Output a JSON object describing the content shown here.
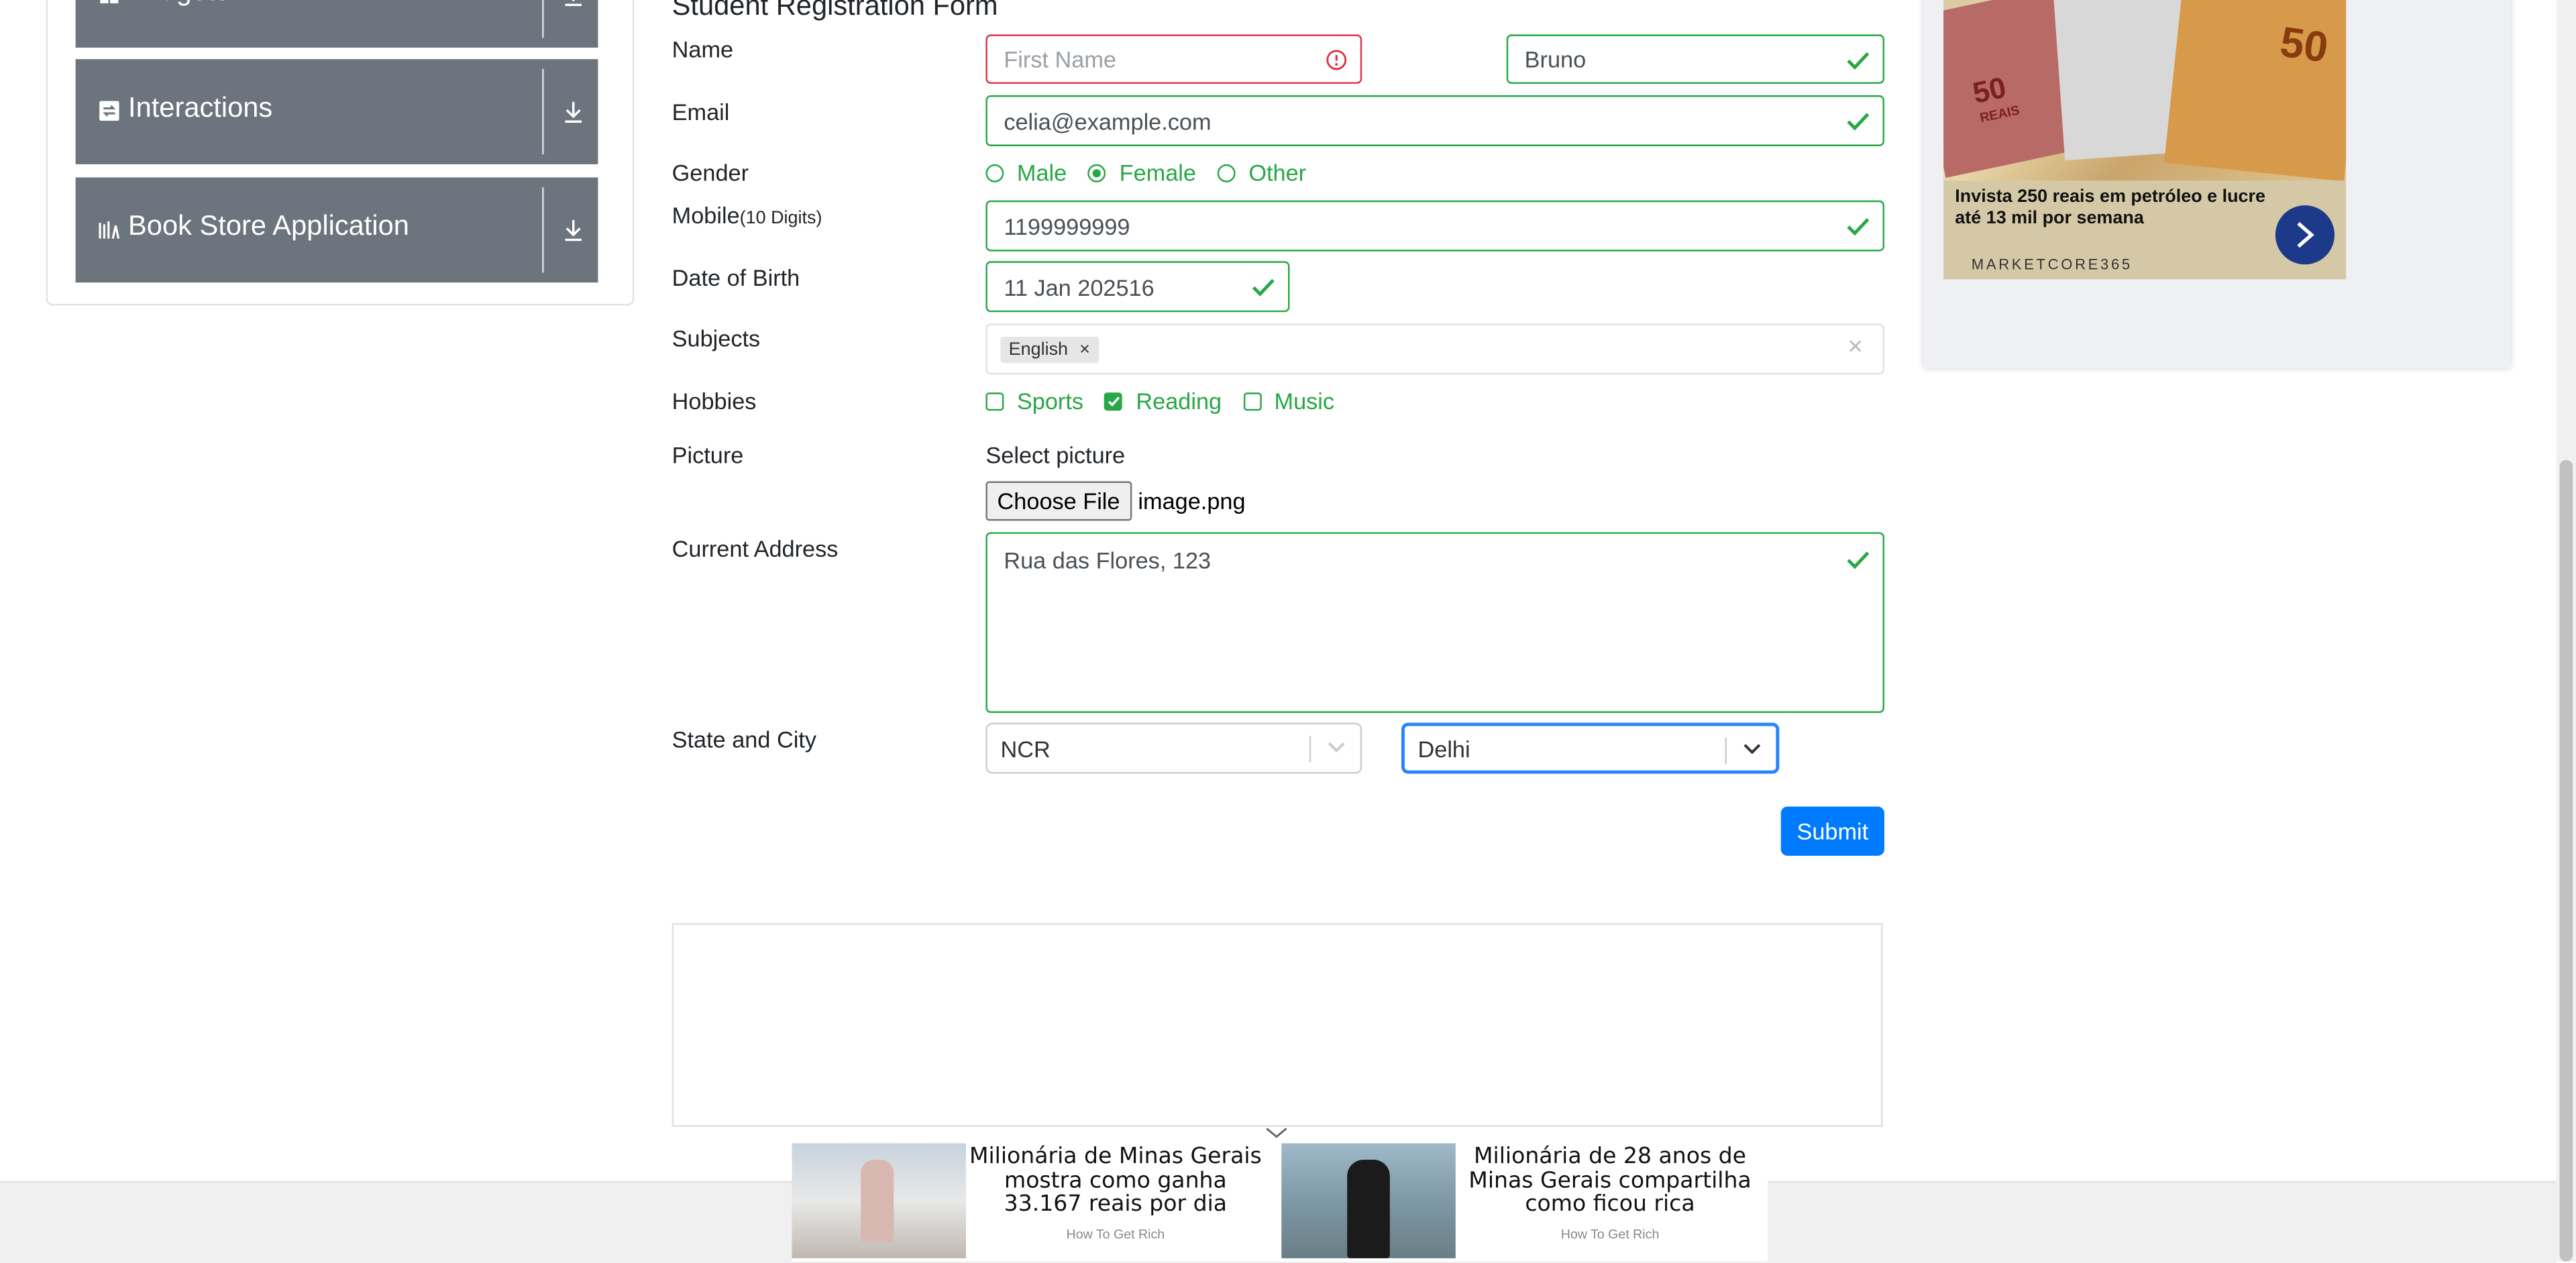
{
  "sidebar": {
    "groups": [
      {
        "title": "Widgets"
      },
      {
        "title": "Interactions"
      },
      {
        "title": "Book Store Application"
      }
    ]
  },
  "form": {
    "title": "Student Registration Form",
    "labels": {
      "name": "Name",
      "email": "Email",
      "gender": "Gender",
      "mobile": "Mobile",
      "mobile_hint": "(10 Digits)",
      "dob": "Date of Birth",
      "subjects": "Subjects",
      "hobbies": "Hobbies",
      "picture": "Picture",
      "address": "Current Address",
      "state_city": "State and City"
    },
    "first_name": {
      "value": "",
      "placeholder": "First Name"
    },
    "last_name": {
      "value": "Bruno"
    },
    "email": {
      "value": "celia@example.com"
    },
    "gender": {
      "options": [
        "Male",
        "Female",
        "Other"
      ],
      "selected": "Female"
    },
    "mobile": {
      "value": "1199999999"
    },
    "dob": {
      "value": "11 Jan 202516"
    },
    "subjects": {
      "chips": [
        "English"
      ]
    },
    "hobbies": {
      "options": [
        "Sports",
        "Reading",
        "Music"
      ],
      "checked": [
        "Reading"
      ]
    },
    "picture": {
      "select_label": "Select picture",
      "button_label": "Choose File",
      "file_name": "image.png"
    },
    "address": {
      "value": "Rua das Flores, 123"
    },
    "state": {
      "value": "NCR"
    },
    "city": {
      "value": "Delhi"
    },
    "submit_label": "Submit"
  },
  "ads": {
    "right": {
      "headline": "Invista 250 reais em petróleo e lucre até 13 mil por semana",
      "brand": "MARKETCORE365",
      "banknote_text": "50",
      "banknote_word": "REAIS"
    },
    "bottom": [
      {
        "headline": "Milionária de Minas Gerais mostra como ganha 33.167 reais por dia",
        "source": "How To Get Rich"
      },
      {
        "headline": "Milionária de 28 anos de Minas Gerais compartilha como ficou rica",
        "source": "How To Get Rich"
      }
    ]
  },
  "colors": {
    "valid": "#28a745",
    "invalid": "#dc3545",
    "primary": "#007bff",
    "sidebar": "#6c757d"
  }
}
